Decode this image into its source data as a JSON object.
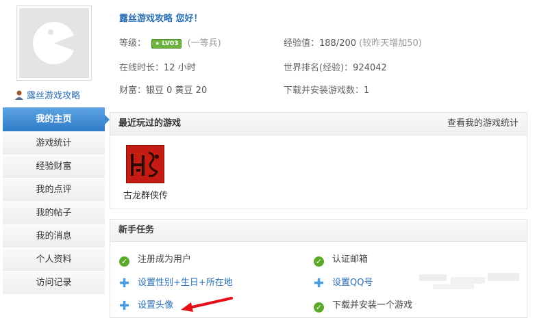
{
  "user": {
    "name": "露丝游戏攻略",
    "greeting": "露丝游戏攻略  您好！"
  },
  "profile": {
    "level_label": "等级：",
    "level_badge": "LV03",
    "level_title": "(一等兵)",
    "exp_label": "经验值：",
    "exp_value": "188/200",
    "exp_note": "(较昨天增加50)",
    "online_label": "在线时长：",
    "online_value": "12 小时",
    "rank_label": "世界排名(经验)：",
    "rank_value": "924042",
    "wealth_label": "财富：",
    "wealth_value": "银豆 0  黄豆 20",
    "downloads_label": "下载并安装游戏数：",
    "downloads_value": "1"
  },
  "nav": [
    {
      "label": "我的主页",
      "active": true
    },
    {
      "label": "游戏统计"
    },
    {
      "label": "经验财富"
    },
    {
      "label": "我的点评"
    },
    {
      "label": "我的帖子"
    },
    {
      "label": "我的消息"
    },
    {
      "label": "个人资料"
    },
    {
      "label": "访问记录"
    }
  ],
  "recent": {
    "title": "最近玩过的游戏",
    "link": "查看我的游戏统计",
    "games": [
      {
        "name": "古龙群侠传",
        "icon": "gulong-game-icon"
      }
    ]
  },
  "tasks": {
    "title": "新手任务",
    "items": [
      {
        "label": "注册成为用户",
        "done": true
      },
      {
        "label": "认证邮箱",
        "done": true
      },
      {
        "label": "设置性别+生日+所在地",
        "done": false
      },
      {
        "label": "设置QQ号",
        "done": false
      },
      {
        "label": "设置头像",
        "done": false
      },
      {
        "label": "下载并安装一个游戏",
        "done": true
      }
    ]
  },
  "colors": {
    "accent": "#2f7cc8",
    "link": "#2a6fb3",
    "check": "#5aaa2a",
    "arrow": "#e3101a"
  }
}
